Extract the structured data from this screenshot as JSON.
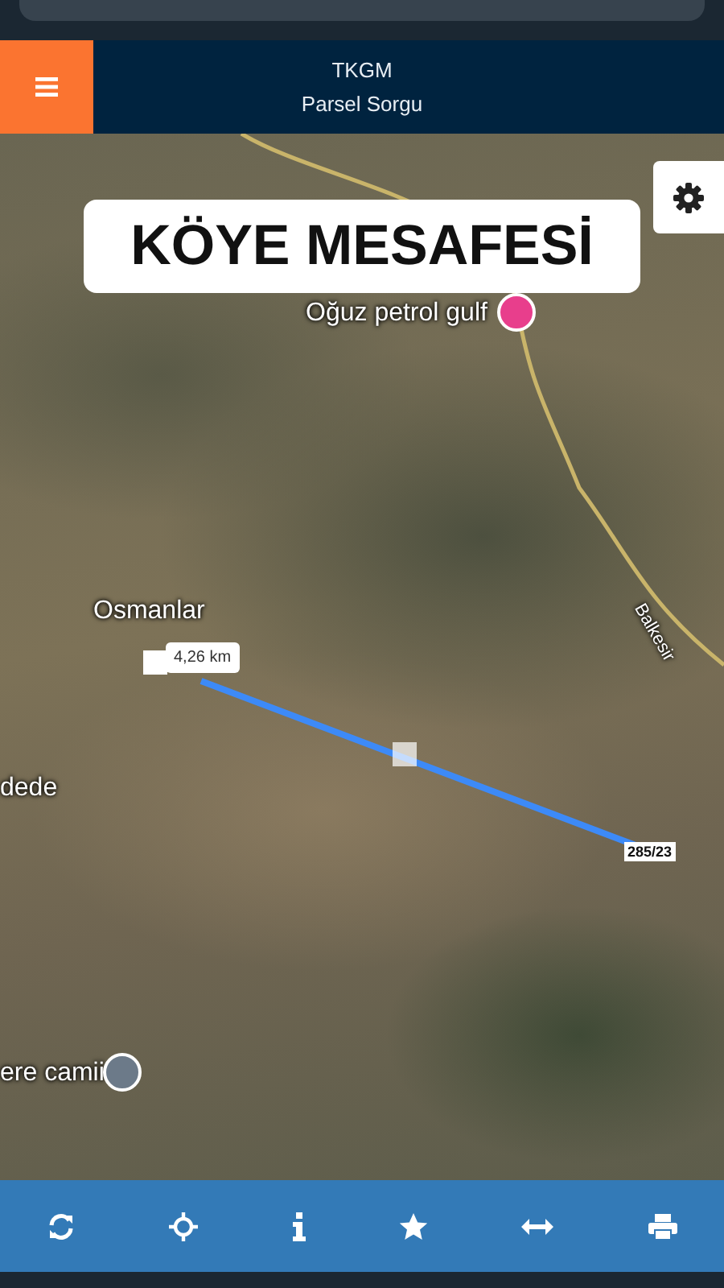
{
  "header": {
    "title": "TKGM",
    "subtitle": "Parsel Sorgu"
  },
  "caption": "KÖYE MESAFESİ",
  "map_labels": [
    {
      "text": "Oğuz petrol gulf",
      "kind": "poi",
      "color": "#e83e8c"
    },
    {
      "text": "Osmanlar",
      "kind": "place"
    },
    {
      "text": "Balkesir",
      "kind": "road"
    },
    {
      "text": "dede",
      "kind": "place"
    },
    {
      "text": "ere camii",
      "kind": "poi",
      "color": "#6c7a89"
    }
  ],
  "measurement": {
    "distance": "4,26 km",
    "parcel": "285/23"
  },
  "toolbar": [
    {
      "kind": "refresh"
    },
    {
      "kind": "locate"
    },
    {
      "kind": "info"
    },
    {
      "kind": "star"
    },
    {
      "kind": "measure"
    },
    {
      "kind": "print"
    }
  ]
}
